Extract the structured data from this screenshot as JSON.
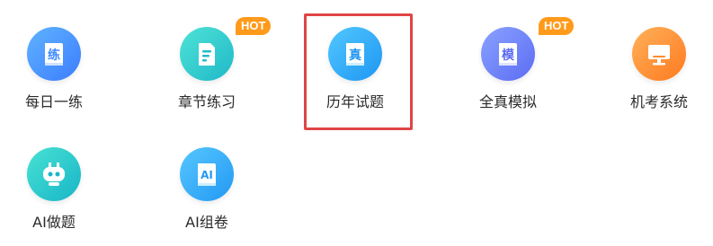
{
  "hot_badge": "HOT",
  "tiles": [
    {
      "label": "每日一练",
      "glyph": "练",
      "icon": "book-lian-icon",
      "hot": false,
      "colors": [
        "#5fb3ff",
        "#3c7dff"
      ]
    },
    {
      "label": "章节练习",
      "glyph": "",
      "icon": "document-icon",
      "hot": true,
      "colors": [
        "#4fe3d5",
        "#1fb8c9"
      ]
    },
    {
      "label": "历年试题",
      "glyph": "真",
      "icon": "book-zhen-icon",
      "hot": false,
      "colors": [
        "#52c8ff",
        "#1e96f2"
      ],
      "selected": true
    },
    {
      "label": "全真模拟",
      "glyph": "模",
      "icon": "book-mo-icon",
      "hot": true,
      "colors": [
        "#8aa2ff",
        "#5b6cf3"
      ]
    },
    {
      "label": "机考系统",
      "glyph": "",
      "icon": "monitor-icon",
      "hot": false,
      "colors": [
        "#ffb15a",
        "#ff7a1f"
      ]
    },
    {
      "label": "AI做题",
      "glyph": "",
      "icon": "robot-icon",
      "hot": false,
      "colors": [
        "#48e2d3",
        "#18b5c8"
      ]
    },
    {
      "label": "AI组卷",
      "glyph": "AI",
      "icon": "ai-paper-icon",
      "hot": false,
      "colors": [
        "#56c7ff",
        "#2399f3"
      ]
    }
  ]
}
